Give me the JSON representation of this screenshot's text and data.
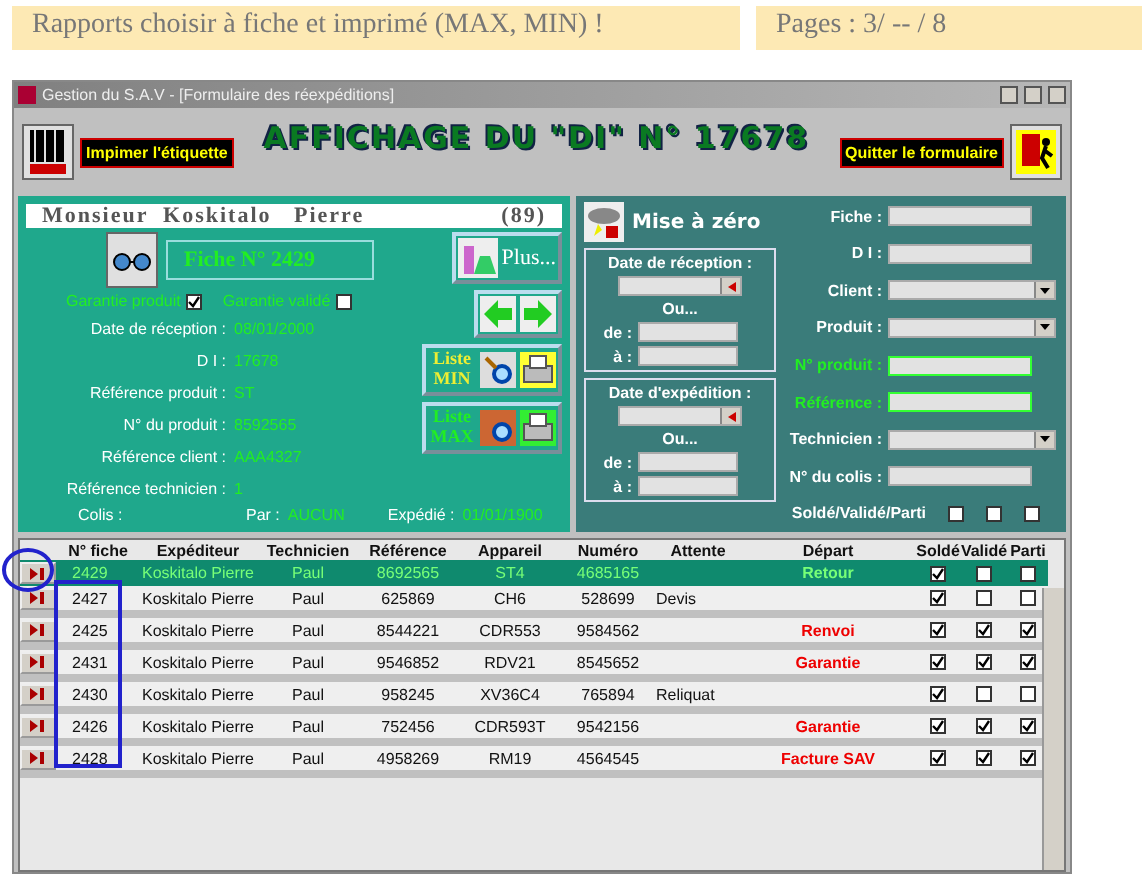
{
  "banner": {
    "title": "Rapports choisir à fiche et imprimé (MAX, MIN) !",
    "pages": "Pages : 3/ -- / 8"
  },
  "window": {
    "title": "Gestion du S.A.V - [Formulaire des réexpéditions]"
  },
  "toolbar": {
    "print_label": "Impimer  l'étiquette",
    "heading": "AFFICHAGE DU  \"DI\"  N° 17678",
    "quit": "Quitter le formulaire"
  },
  "client": {
    "name": "Monsieur  Koskitalo   Pierre",
    "count": "(89)"
  },
  "fiche": "Fiche N° 2429",
  "guarantees": [
    {
      "label": "Garantie produit",
      "checked": true
    },
    {
      "label": "Garantie validé",
      "checked": false
    }
  ],
  "details": [
    {
      "label": "Date de réception :",
      "value": "08/01/2000"
    },
    {
      "label": "D I :",
      "value": "17678"
    },
    {
      "label": "Référence produit :",
      "value": "ST"
    },
    {
      "label": "N° du produit :",
      "value": "8592565"
    },
    {
      "label": "Référence client :",
      "value": "AAA4327"
    },
    {
      "label": "Référence technicien :",
      "value": "1"
    }
  ],
  "footer": {
    "colis": "Colis :",
    "par_label": "Par :",
    "par_value": "AUCUN",
    "expedie_label": "Expédié :",
    "expedie_value": "01/01/1900"
  },
  "buttons": {
    "plus": "Plus...",
    "list_min": [
      "Liste",
      "MIN"
    ],
    "list_max": [
      "Liste",
      "MAX"
    ]
  },
  "reset": "Mise à zéro",
  "date_groups": [
    {
      "title": "Date de réception :",
      "or": "Ou...",
      "from": "de :",
      "to": "à :"
    },
    {
      "title": "Date d'expédition :",
      "or": "Ou...",
      "from": "de :",
      "to": "à :"
    }
  ],
  "filters": [
    {
      "label": "Fiche :",
      "kind": "text",
      "highlight": false
    },
    {
      "label": "D I :",
      "kind": "text",
      "highlight": false
    },
    {
      "label": "Client :",
      "kind": "combo",
      "highlight": false
    },
    {
      "label": "Produit :",
      "kind": "combo",
      "highlight": false
    },
    {
      "label": "N° produit :",
      "kind": "text",
      "highlight": true
    },
    {
      "label": "Référence :",
      "kind": "text",
      "highlight": true
    },
    {
      "label": "Technicien :",
      "kind": "combo",
      "highlight": false
    },
    {
      "label": "N° du colis :",
      "kind": "text",
      "highlight": false
    }
  ],
  "status_filter": {
    "label": "Soldé/Validé/Parti",
    "checks": [
      false,
      false,
      false
    ]
  },
  "table": {
    "columns": [
      "N° fiche",
      "Expéditeur",
      "Technicien",
      "Référence",
      "Appareil",
      "Numéro",
      "Attente",
      "Départ",
      "Soldé",
      "Validé",
      "Parti"
    ],
    "rows": [
      {
        "selected": true,
        "fiche": "2429",
        "last": "Koskitalo",
        "first": "Pierre",
        "tech": "Paul",
        "ref": "8692565",
        "device": "ST4",
        "number": "4685165",
        "wait": "",
        "depart": "Retour",
        "solde": true,
        "valide": false,
        "parti": false
      },
      {
        "selected": false,
        "fiche": "2427",
        "last": "Koskitalo",
        "first": "Pierre",
        "tech": "Paul",
        "ref": "625869",
        "device": "CH6",
        "number": "528699",
        "wait": "Devis",
        "depart": "",
        "solde": true,
        "valide": false,
        "parti": false
      },
      {
        "selected": false,
        "fiche": "2425",
        "last": "Koskitalo",
        "first": "Pierre",
        "tech": "Paul",
        "ref": "8544221",
        "device": "CDR553",
        "number": "9584562",
        "wait": "",
        "depart": "Renvoi",
        "solde": true,
        "valide": true,
        "parti": true
      },
      {
        "selected": false,
        "fiche": "2431",
        "last": "Koskitalo",
        "first": "Pierre",
        "tech": "Paul",
        "ref": "9546852",
        "device": "RDV21",
        "number": "8545652",
        "wait": "",
        "depart": "Garantie",
        "solde": true,
        "valide": true,
        "parti": true
      },
      {
        "selected": false,
        "fiche": "2430",
        "last": "Koskitalo",
        "first": "Pierre",
        "tech": "Paul",
        "ref": "958245",
        "device": "XV36C4",
        "number": "765894",
        "wait": "Reliquat",
        "depart": "",
        "solde": true,
        "valide": false,
        "parti": false
      },
      {
        "selected": false,
        "fiche": "2426",
        "last": "Koskitalo",
        "first": "Pierre",
        "tech": "Paul",
        "ref": "752456",
        "device": "CDR593T",
        "number": "9542156",
        "wait": "",
        "depart": "Garantie",
        "solde": true,
        "valide": true,
        "parti": true
      },
      {
        "selected": false,
        "fiche": "2428",
        "last": "Koskitalo",
        "first": "Pierre",
        "tech": "Paul",
        "ref": "4958269",
        "device": "RM19",
        "number": "4564545",
        "wait": "",
        "depart": "Facture SAV",
        "solde": true,
        "valide": true,
        "parti": true
      }
    ]
  }
}
